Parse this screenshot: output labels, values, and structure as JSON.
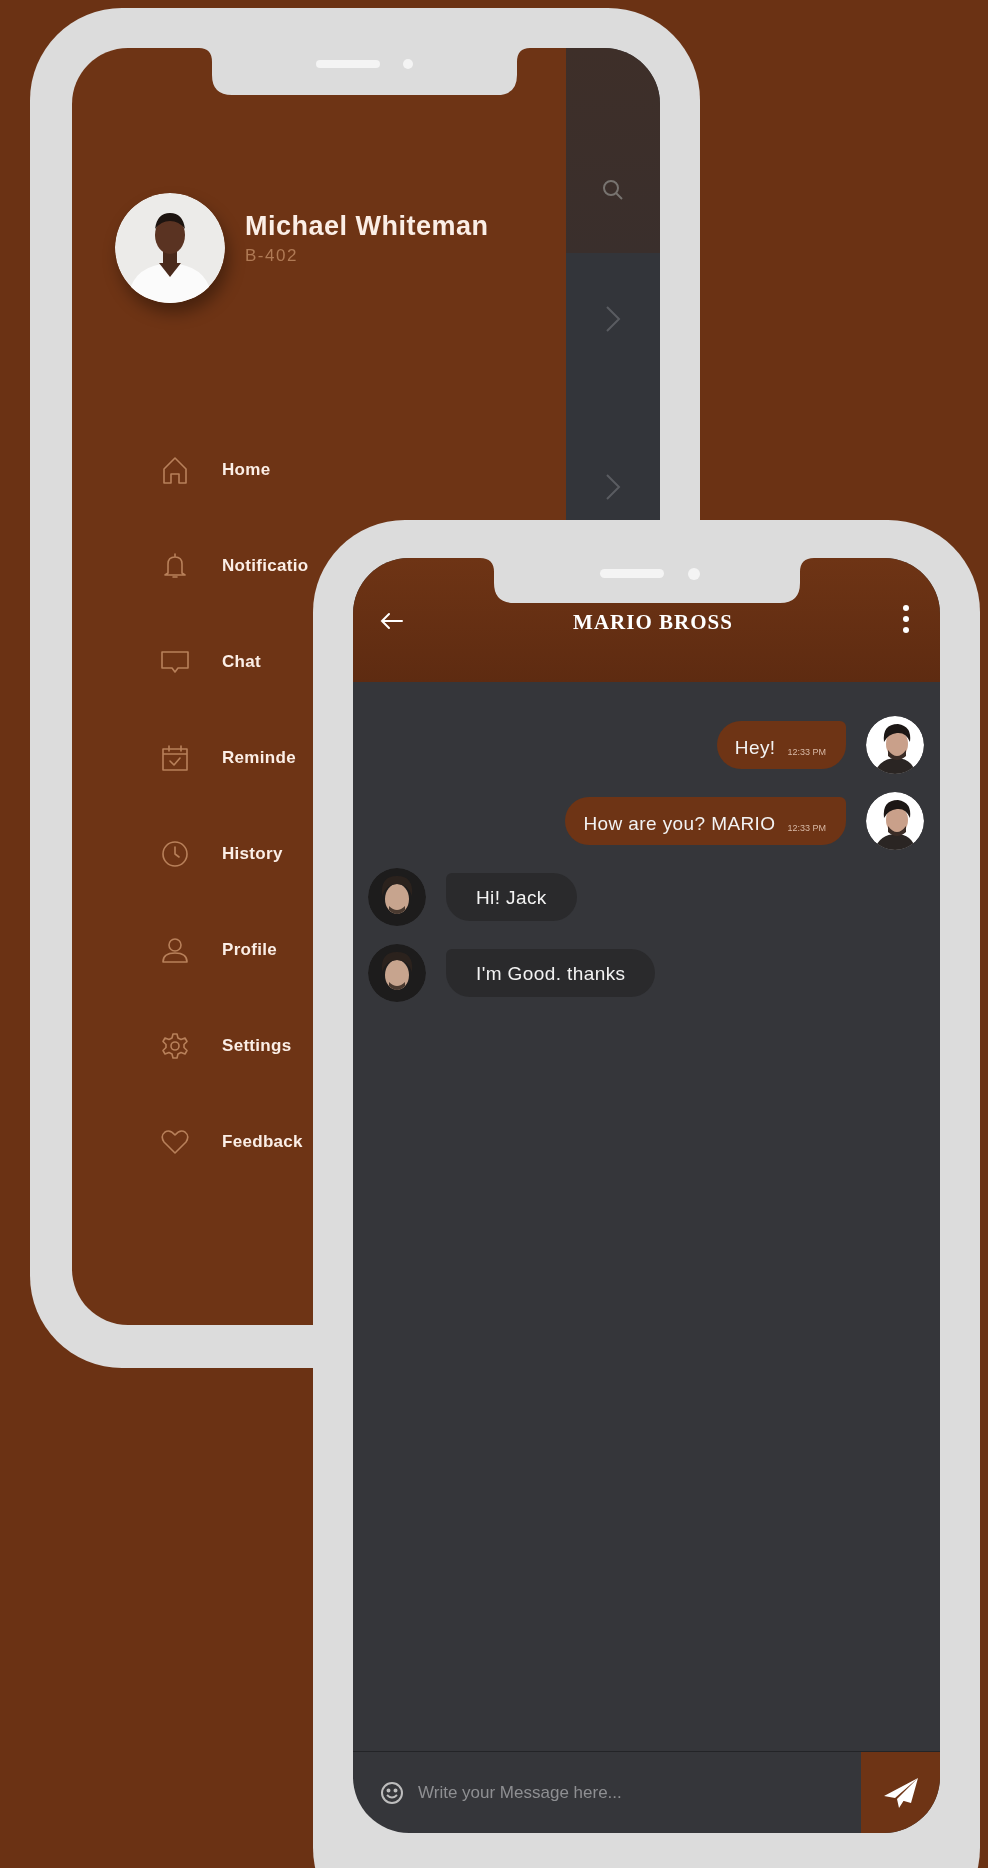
{
  "drawer": {
    "user": {
      "name": "Michael Whiteman",
      "unit": "B-402"
    },
    "items": [
      {
        "kind": "home",
        "label": "Home"
      },
      {
        "kind": "bell",
        "label": "Notificatio"
      },
      {
        "kind": "chat",
        "label": "Chat"
      },
      {
        "kind": "calendar",
        "label": "Reminde"
      },
      {
        "kind": "clock",
        "label": "History"
      },
      {
        "kind": "person",
        "label": "Profile"
      },
      {
        "kind": "gear",
        "label": "Settings"
      },
      {
        "kind": "heart",
        "label": "Feedback"
      }
    ]
  },
  "chat": {
    "title": "MARIO BROSS",
    "messages": [
      {
        "kind": "sent",
        "text": "Hey!",
        "time": "12:33 PM"
      },
      {
        "kind": "sent",
        "text": "How are you? MARIO",
        "time": "12:33 PM"
      },
      {
        "kind": "received",
        "text": "Hi! Jack"
      },
      {
        "kind": "received",
        "text": "I'm Good. thanks"
      }
    ],
    "input": {
      "placeholder": "Write your Message here..."
    }
  }
}
